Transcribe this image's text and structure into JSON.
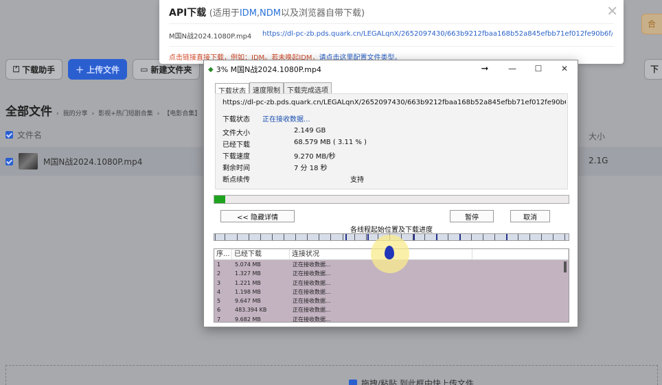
{
  "background": {
    "toolbar": {
      "download_helper": "下载助手",
      "upload": "上传文件",
      "new_folder": "新建文件夹",
      "right_button": "下",
      "right_orange": "合"
    },
    "breadcrumb": {
      "title": "全部文件",
      "crumbs": [
        "我的分享",
        "影视+热门短剧合集",
        "【电影合集】"
      ]
    },
    "table": {
      "col_name": "文件名",
      "col_size": "大小",
      "rows": [
        {
          "name": "M国N战2024.1080P.mp4",
          "size": "2.1G"
        }
      ]
    },
    "drop_text": "拖拽/粘贴 到此框中快上传文件"
  },
  "api_panel": {
    "title": "API下载",
    "subtitle_prefix": "(适用于",
    "idm": "IDM",
    "comma": ",",
    "ndm": "NDM",
    "subtitle_suffix": "以及浏览器自带下载)",
    "file_name": "M国N战2024.1080P.mp4",
    "url": "https://dl-pc-zb.pds.quark.cn/LEGALqnX/2652097430/663b9212fbaa168b52a845efbb71ef012fe90b6f/663b921...",
    "note": "点击链接直接下载，例如：IDM。若未唤起IDM，",
    "note_link": "请点击这里配置文件类型。"
  },
  "dialog": {
    "title": "3% M国N战2024.1080P.mp4",
    "tabs": [
      "下载状态",
      "速度限制",
      "下载完成选项"
    ],
    "url": "https://dl-pc-zb.pds.quark.cn/LEGALqnX/2652097430/663b9212fbaa168b52a845efbb71ef012fe90b6f/663b921",
    "status_label": "下载状态",
    "status_value": "正在接收数据...",
    "fields": [
      {
        "label": "文件大小",
        "value": "2.149  GB"
      },
      {
        "label": "已经下载",
        "value": "68.579  MB  ( 3.11 % )"
      },
      {
        "label": "下载速度",
        "value": "9.270  MB/秒"
      },
      {
        "label": "剩余时间",
        "value": "7 分 18 秒"
      },
      {
        "label": "断点续传",
        "value": "支持"
      }
    ],
    "progress_percent": 3.11,
    "hide_details": "<< 隐藏详情",
    "pause": "暂停",
    "cancel": "取消",
    "segments_label": "各线程起始位置及下载进度",
    "list_headers": [
      "序...",
      "已经下载",
      "连接状况"
    ],
    "connections": [
      {
        "no": "1",
        "downloaded": "5.074  MB",
        "status": "正在接收数据..."
      },
      {
        "no": "2",
        "downloaded": "1.327  MB",
        "status": "正在接收数据..."
      },
      {
        "no": "3",
        "downloaded": "1.221  MB",
        "status": "正在接收数据..."
      },
      {
        "no": "4",
        "downloaded": "1.198  MB",
        "status": "正在接收数据..."
      },
      {
        "no": "5",
        "downloaded": "9.647  MB",
        "status": "正在接收数据..."
      },
      {
        "no": "6",
        "downloaded": "483.394  KB",
        "status": "正在接收数据..."
      },
      {
        "no": "7",
        "downloaded": "9.682  MB",
        "status": "正在接收数据..."
      }
    ]
  }
}
